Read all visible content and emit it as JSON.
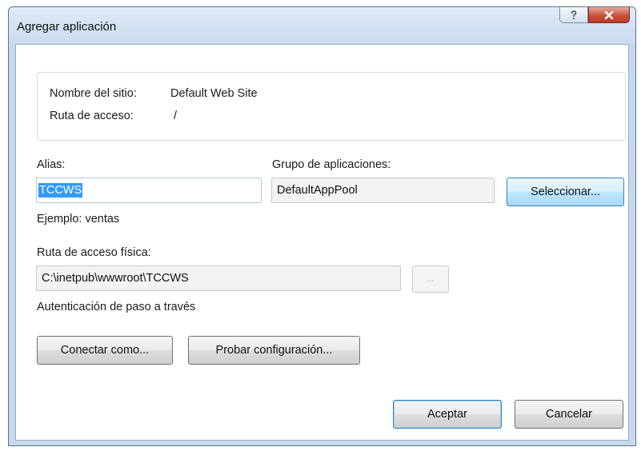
{
  "dialog": {
    "title": "Agregar aplicación",
    "help_glyph": "?",
    "close_glyph": "X"
  },
  "site": {
    "name_label": "Nombre del sitio:",
    "name_value": "Default Web Site",
    "path_label": "Ruta de acceso:",
    "path_value": "/"
  },
  "alias": {
    "label": "Alias:",
    "value": "TCCWS",
    "example": "Ejemplo: ventas"
  },
  "app_pool": {
    "label": "Grupo de aplicaciones:",
    "value": "DefaultAppPool",
    "select_button": "Seleccionar..."
  },
  "physical_path": {
    "label": "Ruta de acceso física:",
    "value": "C:\\inetpub\\wwwroot\\TCCWS",
    "browse_button": "...",
    "auth_text": "Autenticación de paso a través"
  },
  "actions": {
    "connect_as": "Conectar como...",
    "test_settings": "Probar configuración...",
    "ok": "Aceptar",
    "cancel": "Cancelar"
  },
  "colors": {
    "selection": "#3399ff",
    "close_button": "#c9503c",
    "frame": "#c7d9ec"
  },
  "icons": {
    "help": "help-icon",
    "close": "close-icon"
  }
}
